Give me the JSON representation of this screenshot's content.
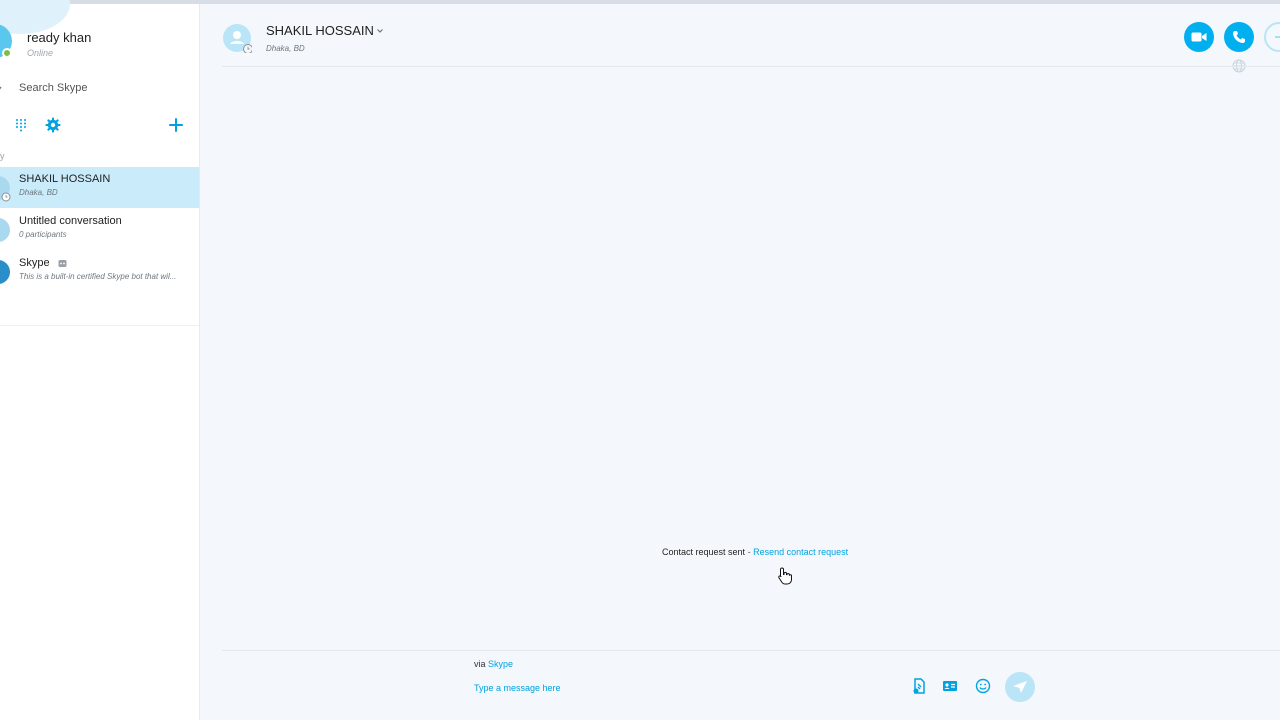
{
  "profile": {
    "name": "ready khan",
    "presence": "Online"
  },
  "search": {
    "placeholder": "Search Skype"
  },
  "sidebar": {
    "section_fragment": "y",
    "conversations": [
      {
        "title": "SHAKIL HOSSAIN",
        "subtitle": "Dhaka, BD",
        "active": true
      },
      {
        "title": "Untitled conversation",
        "subtitle": "0 participants",
        "active": false
      },
      {
        "title": "Skype",
        "subtitle": "This is a built-in certified Skype bot that wil...",
        "active": false
      }
    ]
  },
  "header": {
    "name": "SHAKIL HOSSAIN",
    "location": "Dhaka, BD"
  },
  "notice": {
    "text": "Contact request sent",
    "separator": "-",
    "link": "Resend contact request"
  },
  "composer": {
    "via_prefix": "via",
    "via_link": "Skype",
    "placeholder": "Type a message here"
  },
  "colors": {
    "accent": "#00aff0",
    "active_row": "#c9ebfa",
    "online": "#7bc043"
  }
}
